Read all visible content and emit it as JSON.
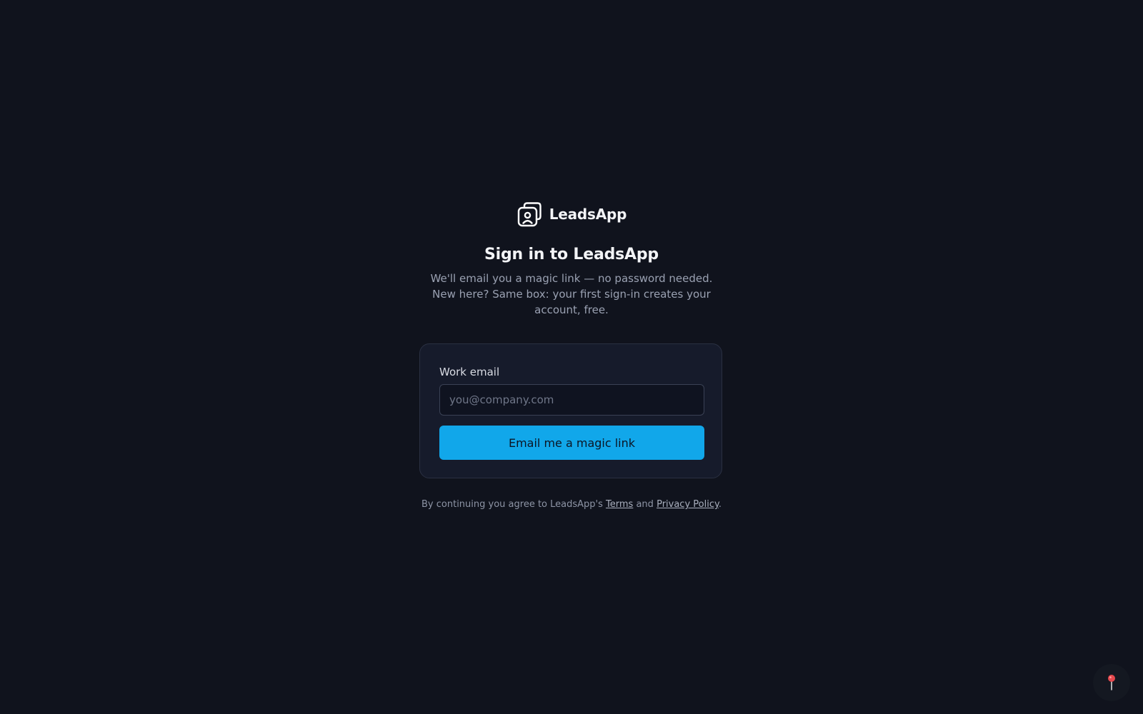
{
  "brand": {
    "name": "LeadsApp",
    "logo_icon": "stacked-contact-cards-icon"
  },
  "title": "Sign in to LeadsApp",
  "subtitle": "We'll email you a magic link — no password needed. New here? Same box: your first sign-in creates your account, free.",
  "form": {
    "email_label": "Work email",
    "email_value": "",
    "email_placeholder": "you@company.com",
    "submit_label": "Email me a magic link"
  },
  "legal": {
    "prefix": "By continuing you agree to LeadsApp's",
    "terms_label": "Terms",
    "and": "and",
    "privacy_label": "Privacy Policy",
    "suffix": "."
  },
  "floating_button": {
    "icon": "pin-icon"
  },
  "colors": {
    "background": "#10131d",
    "card": "#161b2b",
    "accent": "#11a7ea",
    "pin": "#e5484d"
  }
}
